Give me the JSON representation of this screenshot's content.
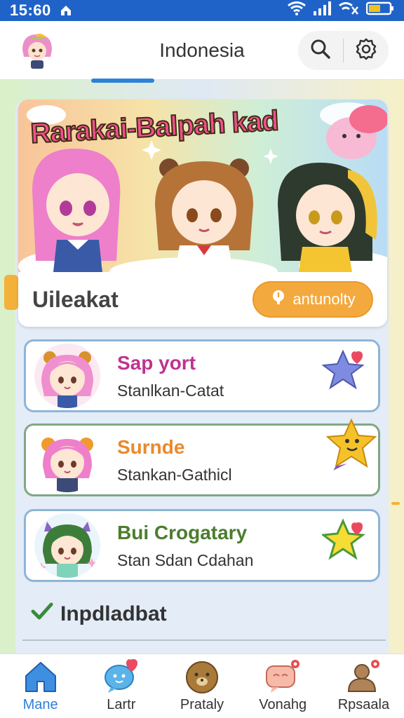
{
  "status_bar": {
    "time": "15:60"
  },
  "app_bar": {
    "title": "Indonesia"
  },
  "banner": {
    "title": "Rarakai-Balpah kad",
    "heading": "Uileakat",
    "action_label": "antunolty"
  },
  "list_items": [
    {
      "name": "Sap yort",
      "subtitle": "Stanlkan-Catat",
      "name_color": "#c0338f"
    },
    {
      "name": "Surnde",
      "subtitle": "Stankan-Gathicl",
      "name_color": "#e98a2d"
    },
    {
      "name": "Bui Crogatary",
      "subtitle": "Stan Sdan Cdahan",
      "name_color": "#4c7d2e"
    }
  ],
  "section": {
    "heading": "Inpdladbat"
  },
  "bottom_nav": [
    {
      "label": "Mane",
      "active": true
    },
    {
      "label": "Lartr"
    },
    {
      "label": "Prataly"
    },
    {
      "label": "Vonahg"
    },
    {
      "label": "Rpsaala"
    }
  ],
  "colors": {
    "status_bar": "#1f63c8",
    "accent_orange": "#f4a93e",
    "active_blue": "#2f7fd6"
  }
}
